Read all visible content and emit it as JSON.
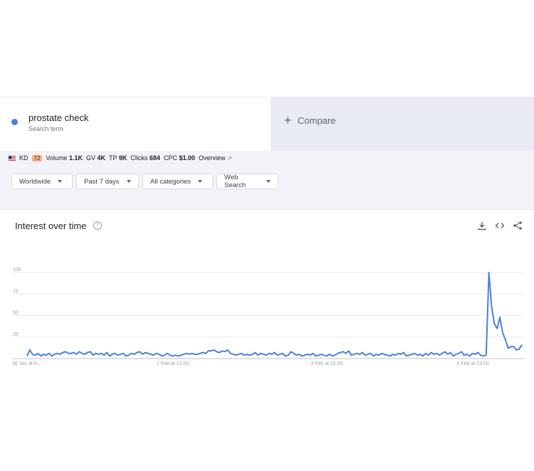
{
  "search_term": {
    "name": "prostate check",
    "subtitle": "Search term"
  },
  "compare": {
    "plus": "+",
    "label": "Compare"
  },
  "metrics": {
    "kd_label": "KD",
    "kd_value": "72",
    "volume_label": "Volume",
    "volume_value": "1.1K",
    "gv_label": "GV",
    "gv_value": "4K",
    "tp_label": "TP",
    "tp_value": "9K",
    "clicks_label": "Clicks",
    "clicks_value": "684",
    "cpc_label": "CPC",
    "cpc_value": "$1.00",
    "overview_label": "Overview"
  },
  "filters": [
    {
      "label": "Worldwide"
    },
    {
      "label": "Past 7 days"
    },
    {
      "label": "All categories"
    },
    {
      "label": "Web Search"
    }
  ],
  "chart_header": {
    "title": "Interest over time",
    "help_glyph": "?"
  },
  "icons": {
    "term_dot": "dot-icon",
    "download": "download-icon",
    "embed": "embed-icon",
    "share": "share-icon",
    "help": "help-icon",
    "external": "external-link-icon",
    "flag": "us-flag-icon"
  },
  "colors": {
    "series": "#4a7fe0",
    "compare_bg": "#e8ebf3",
    "band_bg": "#f1f3f8",
    "kd_badge": "#f6b08a"
  },
  "chart_data": {
    "type": "line",
    "title": "",
    "xlabel": "",
    "ylabel": "",
    "ylim": [
      0,
      100
    ],
    "yticks": [
      25,
      50,
      75,
      100
    ],
    "ytick_labels": [
      "25",
      "50",
      "75",
      "100"
    ],
    "xtick_labels": [
      "30 Jan at 0...",
      "1 Feb at 12:00",
      "3 Feb at 15:00",
      "5 Feb at 23:00"
    ],
    "xtick_indices": [
      0,
      53,
      109,
      168
    ],
    "grid": true,
    "series": [
      {
        "values": [
          3,
          10,
          5,
          4,
          6,
          3,
          5,
          4,
          6,
          3,
          5,
          6,
          5,
          7,
          8,
          6,
          6,
          7,
          5,
          8,
          6,
          5,
          7,
          8,
          4,
          6,
          5,
          6,
          4,
          7,
          3,
          5,
          6,
          4,
          5,
          6,
          3,
          4,
          6,
          5,
          7,
          8,
          5,
          7,
          6,
          5,
          4,
          6,
          5,
          3,
          4,
          6,
          4,
          3,
          4,
          3,
          4,
          5,
          6,
          5,
          6,
          5,
          5,
          6,
          7,
          6,
          9,
          9,
          10,
          8,
          7,
          9,
          8,
          10,
          6,
          5,
          4,
          5,
          6,
          4,
          5,
          4,
          5,
          7,
          4,
          6,
          5,
          4,
          6,
          5,
          7,
          4,
          5,
          6,
          3,
          4,
          8,
          6,
          4,
          5,
          3,
          4,
          5,
          4,
          6,
          3,
          4,
          5,
          4,
          3,
          5,
          3,
          4,
          6,
          7,
          8,
          6,
          9,
          4,
          5,
          6,
          5,
          7,
          4,
          5,
          6,
          3,
          5,
          4,
          6,
          5,
          4,
          3,
          5,
          4,
          6,
          5,
          7,
          3,
          4,
          5,
          6,
          4,
          5,
          3,
          6,
          4,
          7,
          5,
          6,
          4,
          6,
          8,
          5,
          7,
          3,
          5,
          6,
          8,
          4,
          5,
          3,
          6,
          5,
          7,
          4,
          3,
          4,
          100,
          60,
          40,
          35,
          48,
          30,
          22,
          12,
          14,
          14,
          10,
          11,
          16
        ]
      }
    ]
  }
}
